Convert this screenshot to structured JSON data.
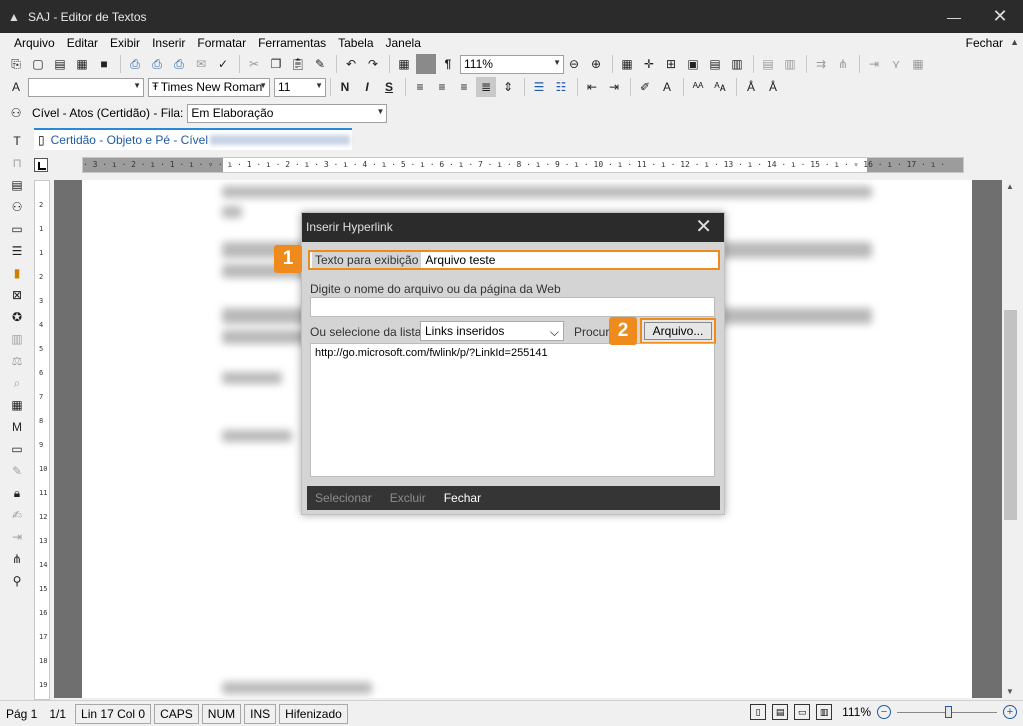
{
  "window": {
    "title": "SAJ - Editor de Textos"
  },
  "menu": {
    "items": [
      "Arquivo",
      "Editar",
      "Exibir",
      "Inserir",
      "Formatar",
      "Ferramentas",
      "Tabela",
      "Janela"
    ],
    "right": "Fechar"
  },
  "toolbar": {
    "zoom_value": "111%",
    "font_name": "Times New Roman",
    "font_size": "11",
    "style_value": "",
    "bold": "N",
    "italic": "I",
    "strike": "S",
    "pilcrow": "¶",
    "filter_label": "Cível - Atos (Certidão) - Fila:",
    "filter_value": "Em Elaboração"
  },
  "tab": {
    "label": "Certidão - Objeto e Pé - Cível"
  },
  "ruler": {
    "ticks": "· 3 · ı · 2 · ı · 1 · ı · ▿ · ı · 1 · ı · 2 · ı · 3 · ı · 4 · ı · 5 · ı · 6 · ı · 7 · ı · 8 · ı · 9 · ı · 10 · ı · 11 · ı · 12 · ı · 13 · ı · 14 · ı · 15 · ı · ▿ 16 · ı · 17 · ı ·"
  },
  "vruler": {
    "ticks": [
      "2",
      "1",
      "1",
      "2",
      "3",
      "4",
      "5",
      "6",
      "7",
      "8",
      "9",
      "10",
      "11",
      "12",
      "13",
      "14",
      "15",
      "16",
      "17",
      "18",
      "19"
    ]
  },
  "dialog": {
    "title": "Inserir Hyperlink",
    "display_text_label": "Texto para exibição",
    "display_text_value": "Arquivo teste",
    "url_label": "Digite o nome do arquivo ou da página da Web",
    "url_value": "",
    "select_label": "Ou selecione da lista",
    "select_value": "Links inseridos",
    "browse_label": "Procur",
    "browse_button": "Arquivo...",
    "list_items": [
      "http://go.microsoft.com/fwlink/p/?LinkId=255141"
    ],
    "footer": {
      "select": "Selecionar",
      "delete": "Excluir",
      "close": "Fechar"
    }
  },
  "badges": [
    "1",
    "2"
  ],
  "status": {
    "page": "Pág 1",
    "pages": "1/1",
    "position": "Lin 17  Col 0",
    "caps": "CAPS",
    "num": "NUM",
    "ins": "INS",
    "hyphen": "Hifenizado",
    "zoom": "111%"
  },
  "colors": {
    "accent_orange": "#ef8a1c",
    "title_dark": "#2b2b2b",
    "link_blue": "#1f5aa6"
  }
}
